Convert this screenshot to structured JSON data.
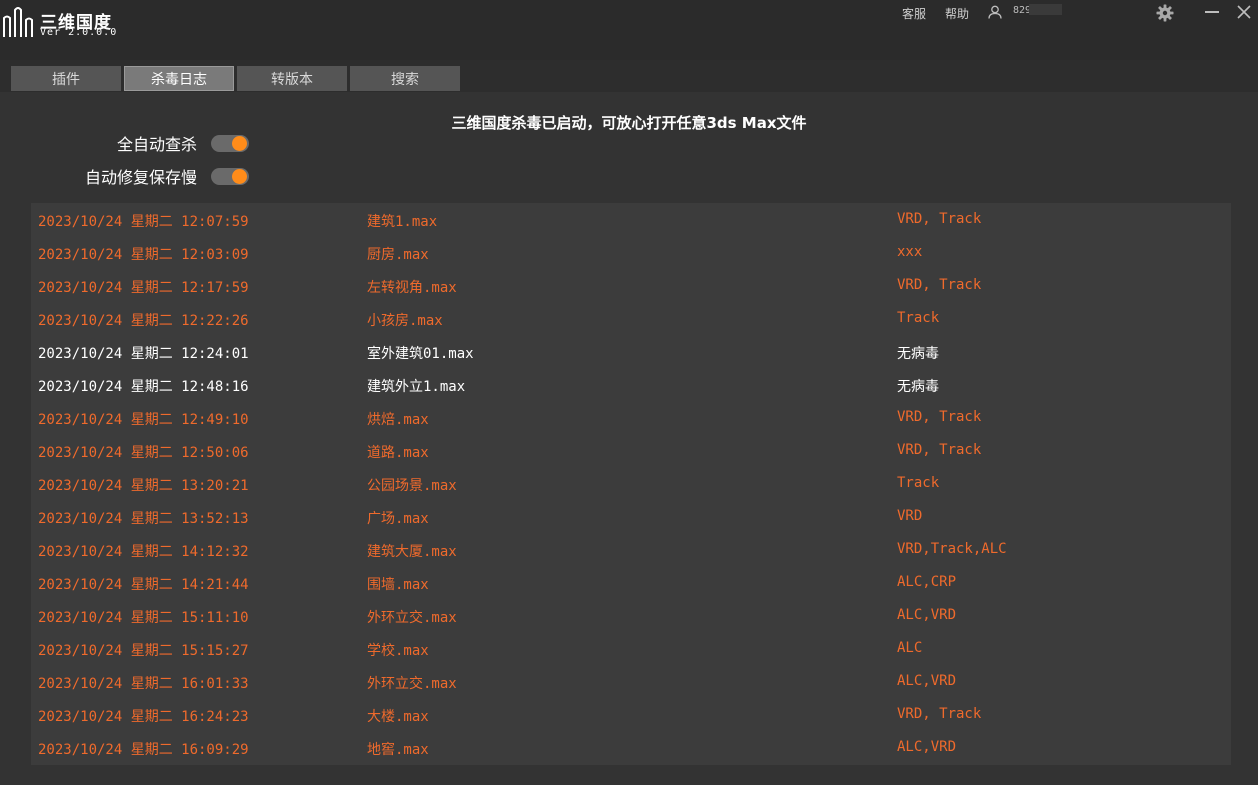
{
  "app": {
    "title": "三维国度",
    "version": "Ver 2.0.0.0"
  },
  "header": {
    "service_label": "客服",
    "help_label": "帮助",
    "user_id": "829"
  },
  "tabs": [
    {
      "label": "插件",
      "active": false
    },
    {
      "label": "杀毒日志",
      "active": true
    },
    {
      "label": "转版本",
      "active": false
    },
    {
      "label": "搜索",
      "active": false
    }
  ],
  "status_message": "三维国度杀毒已启动，可放心打开任意3ds Max文件",
  "toggles": [
    {
      "label": "全自动查杀",
      "on": true
    },
    {
      "label": "自动修复保存慢",
      "on": true
    }
  ],
  "colors": {
    "accent": "#ff8c1a",
    "infected_text": "#ef6a2c",
    "clean_text": "#ffffff"
  },
  "log": [
    {
      "time": "2023/10/24 星期二 12:07:59",
      "file": "建筑1.max",
      "virus": "VRD, Track",
      "status": "infected"
    },
    {
      "time": "2023/10/24 星期二 12:03:09",
      "file": "厨房.max",
      "virus": "xxx",
      "status": "infected"
    },
    {
      "time": "2023/10/24 星期二 12:17:59",
      "file": "左转视角.max",
      "virus": "VRD, Track",
      "status": "infected"
    },
    {
      "time": "2023/10/24 星期二 12:22:26",
      "file": "小孩房.max",
      "virus": "Track",
      "status": "infected"
    },
    {
      "time": "2023/10/24 星期二 12:24:01",
      "file": "室外建筑01.max",
      "virus": "无病毒",
      "status": "clean"
    },
    {
      "time": "2023/10/24 星期二 12:48:16",
      "file": "建筑外立1.max",
      "virus": "无病毒",
      "status": "clean"
    },
    {
      "time": "2023/10/24 星期二 12:49:10",
      "file": "烘焙.max",
      "virus": "VRD, Track",
      "status": "infected"
    },
    {
      "time": "2023/10/24 星期二 12:50:06",
      "file": "道路.max",
      "virus": "VRD, Track",
      "status": "infected"
    },
    {
      "time": "2023/10/24 星期二 13:20:21",
      "file": "公园场景.max",
      "virus": "Track",
      "status": "infected"
    },
    {
      "time": "2023/10/24 星期二 13:52:13",
      "file": "广场.max",
      "virus": "VRD",
      "status": "infected"
    },
    {
      "time": "2023/10/24 星期二 14:12:32",
      "file": "建筑大厦.max",
      "virus": "VRD,Track,ALC",
      "status": "infected"
    },
    {
      "time": "2023/10/24 星期二 14:21:44",
      "file": "围墙.max",
      "virus": "ALC,CRP",
      "status": "infected"
    },
    {
      "time": "2023/10/24 星期二 15:11:10",
      "file": "外环立交.max",
      "virus": "ALC,VRD",
      "status": "infected"
    },
    {
      "time": "2023/10/24 星期二 15:15:27",
      "file": "学校.max",
      "virus": "ALC",
      "status": "infected"
    },
    {
      "time": "2023/10/24 星期二 16:01:33",
      "file": "外环立交.max",
      "virus": "ALC,VRD",
      "status": "infected"
    },
    {
      "time": "2023/10/24 星期二 16:24:23",
      "file": "大楼.max",
      "virus": "VRD, Track",
      "status": "infected"
    },
    {
      "time": "2023/10/24 星期二 16:09:29",
      "file": "地窖.max",
      "virus": "ALC,VRD",
      "status": "infected"
    }
  ]
}
